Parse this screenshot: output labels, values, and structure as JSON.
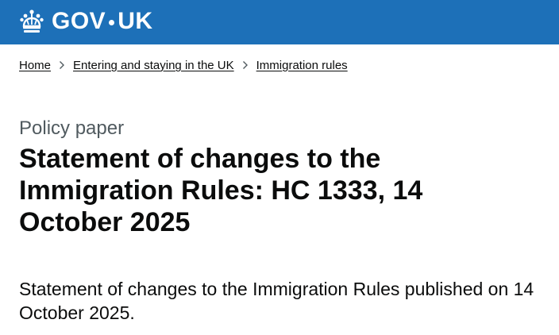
{
  "header": {
    "logo_text_left": "GOV",
    "logo_text_right": "UK",
    "background_color": "#1d70b8",
    "crown_icon": "crown-icon"
  },
  "breadcrumbs": [
    {
      "label": "Home"
    },
    {
      "label": "Entering and staying in the UK"
    },
    {
      "label": "Immigration rules"
    }
  ],
  "main": {
    "document_type": "Policy paper",
    "title": "Statement of changes to the Immigration Rules: HC 1333, 14 October 2025",
    "description": "Statement of changes to the Immigration Rules published on 14 October 2025."
  }
}
